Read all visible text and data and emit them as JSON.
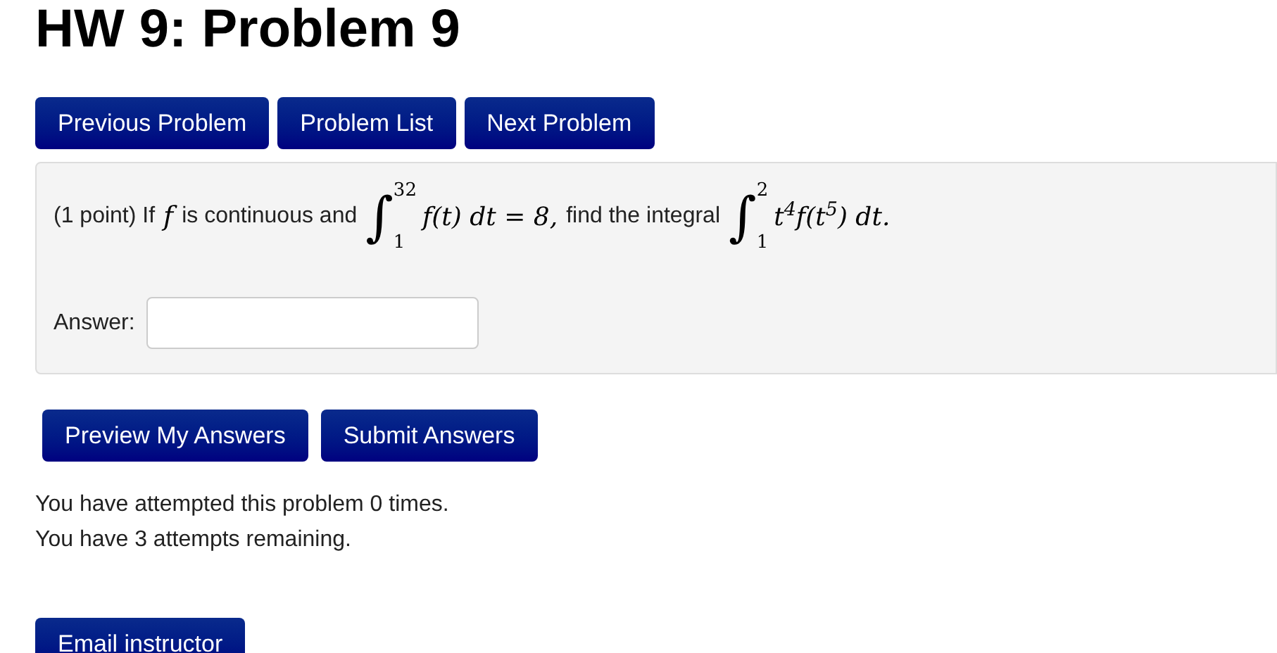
{
  "title": "HW 9: Problem 9",
  "nav_buttons": [
    "Previous Problem",
    "Problem List",
    "Next Problem"
  ],
  "problem": {
    "statement": [
      {
        "kind": "text",
        "text": "(1 point) If"
      },
      {
        "kind": "math",
        "text": "f"
      },
      {
        "kind": "text",
        "text": "is continuous and"
      },
      {
        "kind": "integral",
        "sign": "∫",
        "upper": "32",
        "lower": "1",
        "body": "f(t) dt = 8,"
      },
      {
        "kind": "text",
        "text": "find the integral"
      },
      {
        "kind": "integral",
        "sign": "∫",
        "upper": "2",
        "lower": "1",
        "body": "t$^{4}$f(t$^{5}$) dt."
      }
    ],
    "answer": {
      "label": "Answer:"
    }
  },
  "submit_buttons": [
    "Preview My Answers",
    "Submit Answers"
  ],
  "messages": [
    "You have attempted this problem 0 times.",
    "You have 3 attempts remaining."
  ],
  "email_button": "Email instructor"
}
